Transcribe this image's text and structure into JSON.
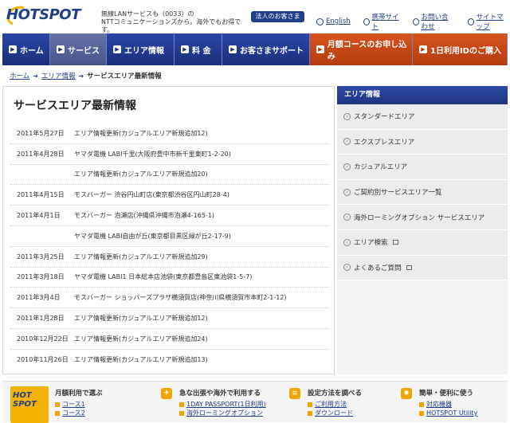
{
  "header": {
    "logo": "HOTSPOT",
    "tagline_line1": "無線LANサービスも（0033）の",
    "tagline_line2": "NTTコミュニケーションズから。海外でもお得です。",
    "corporate_button": "法人のお客さま",
    "util_links": [
      "English",
      "携帯サイト",
      "お問い合わせ",
      "サイトマップ"
    ]
  },
  "nav": {
    "items": [
      "ホーム",
      "サービス",
      "エリア情報",
      "料 金",
      "お客さまサポート"
    ],
    "orange_items": [
      "月額コースのお申し込み",
      "1日利用IDのご購入"
    ],
    "active": "サービス"
  },
  "breadcrumb": {
    "home": "ホーム",
    "area": "エリア情報",
    "current": "サービスエリア最新情報",
    "sep": "➔"
  },
  "main": {
    "title": "サービスエリア最新情報",
    "news": [
      {
        "date": "2011年5月27日",
        "text": "エリア情報更新(カジュアルエリア新規追加12)"
      },
      {
        "date": "2011年4月28日",
        "text": "ヤマダ電機 LABI千里(大阪府豊中市新千里東町1-2-20)"
      },
      {
        "date": "",
        "text": "エリア情報更新(カジュアルエリア新規追加20)"
      },
      {
        "date": "2011年4月15日",
        "text": "モスバーガー 渋谷円山町店(東京都渋谷区円山町28-4)"
      },
      {
        "date": "2011年4月1日",
        "text": "モスバーガー 泡瀬店(沖縄県沖縄市泡瀬4-165-1)"
      },
      {
        "date": "",
        "text": "ヤマダ電機 LABI自由が丘(東京都目黒区緑が丘2-17-9)"
      },
      {
        "date": "2011年3月25日",
        "text": "エリア情報更新(カジュアルエリア新規追加29)"
      },
      {
        "date": "2011年3月18日",
        "text": "ヤマダ電機 LABI1 日本総本店池袋(東京都豊島区東池袋1-5-7)"
      },
      {
        "date": "2011年3月4日",
        "text": "モスバーガー ショッパーズプラザ横須賀店(神奈川県横須賀市本町2-1-12)"
      },
      {
        "date": "2011年1月28日",
        "text": "エリア情報更新(カジュアルエリア新規追加12)"
      },
      {
        "date": "2010年12月22日",
        "text": "エリア情報更新(カジュアルエリア新規追加24)"
      },
      {
        "date": "2010年11月26日",
        "text": "エリア情報更新(カジュアルエリア新規追加13)"
      }
    ]
  },
  "sidebar": {
    "heading": "エリア情報",
    "items": [
      "スタンダードエリア",
      "エクスプレスエリア",
      "カジュアルエリア",
      "ご契約別サービスエリア一覧",
      "海外ローミングオプション サービスエリア",
      "エリア検索",
      "よくあるご質問"
    ]
  },
  "footer": {
    "badge_text": "HOT SPOT",
    "col1": {
      "title": "月額利用で選ぶ",
      "links": [
        "コース1",
        "コース2"
      ]
    },
    "col2": {
      "title": "急な出張や海外で利用する",
      "links": [
        "1DAY PASSPORT(1日利用)",
        "海外ローミングオプション"
      ]
    },
    "col3": {
      "title": "設定方法を調べる",
      "links": [
        "ご利用方法",
        "ダウンロード"
      ]
    },
    "col4": {
      "title": "簡単・便利に使う",
      "links": [
        "対応機器",
        "HOTSPOT Utility"
      ]
    }
  },
  "colors": {
    "brand_blue": "#1f3f8a",
    "accent_orange": "#d8541c",
    "logo_yellow": "#f3b300"
  }
}
